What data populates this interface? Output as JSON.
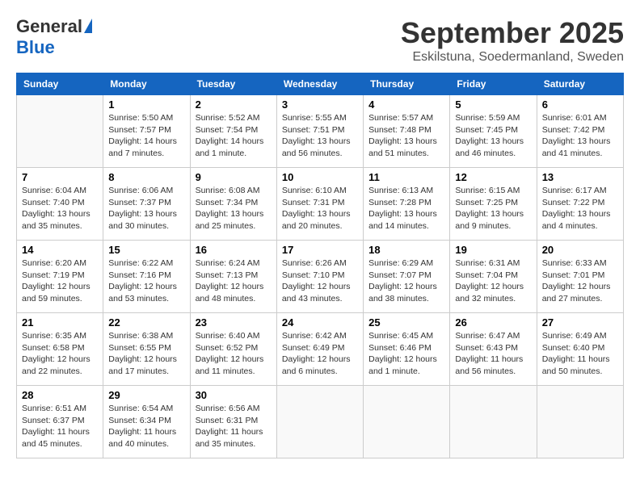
{
  "logo": {
    "general": "General",
    "blue": "Blue"
  },
  "title": "September 2025",
  "location": "Eskilstuna, Soedermanland, Sweden",
  "headers": [
    "Sunday",
    "Monday",
    "Tuesday",
    "Wednesday",
    "Thursday",
    "Friday",
    "Saturday"
  ],
  "weeks": [
    [
      {
        "day": "",
        "info": ""
      },
      {
        "day": "1",
        "info": "Sunrise: 5:50 AM\nSunset: 7:57 PM\nDaylight: 14 hours\nand 7 minutes."
      },
      {
        "day": "2",
        "info": "Sunrise: 5:52 AM\nSunset: 7:54 PM\nDaylight: 14 hours\nand 1 minute."
      },
      {
        "day": "3",
        "info": "Sunrise: 5:55 AM\nSunset: 7:51 PM\nDaylight: 13 hours\nand 56 minutes."
      },
      {
        "day": "4",
        "info": "Sunrise: 5:57 AM\nSunset: 7:48 PM\nDaylight: 13 hours\nand 51 minutes."
      },
      {
        "day": "5",
        "info": "Sunrise: 5:59 AM\nSunset: 7:45 PM\nDaylight: 13 hours\nand 46 minutes."
      },
      {
        "day": "6",
        "info": "Sunrise: 6:01 AM\nSunset: 7:42 PM\nDaylight: 13 hours\nand 41 minutes."
      }
    ],
    [
      {
        "day": "7",
        "info": "Sunrise: 6:04 AM\nSunset: 7:40 PM\nDaylight: 13 hours\nand 35 minutes."
      },
      {
        "day": "8",
        "info": "Sunrise: 6:06 AM\nSunset: 7:37 PM\nDaylight: 13 hours\nand 30 minutes."
      },
      {
        "day": "9",
        "info": "Sunrise: 6:08 AM\nSunset: 7:34 PM\nDaylight: 13 hours\nand 25 minutes."
      },
      {
        "day": "10",
        "info": "Sunrise: 6:10 AM\nSunset: 7:31 PM\nDaylight: 13 hours\nand 20 minutes."
      },
      {
        "day": "11",
        "info": "Sunrise: 6:13 AM\nSunset: 7:28 PM\nDaylight: 13 hours\nand 14 minutes."
      },
      {
        "day": "12",
        "info": "Sunrise: 6:15 AM\nSunset: 7:25 PM\nDaylight: 13 hours\nand 9 minutes."
      },
      {
        "day": "13",
        "info": "Sunrise: 6:17 AM\nSunset: 7:22 PM\nDaylight: 13 hours\nand 4 minutes."
      }
    ],
    [
      {
        "day": "14",
        "info": "Sunrise: 6:20 AM\nSunset: 7:19 PM\nDaylight: 12 hours\nand 59 minutes."
      },
      {
        "day": "15",
        "info": "Sunrise: 6:22 AM\nSunset: 7:16 PM\nDaylight: 12 hours\nand 53 minutes."
      },
      {
        "day": "16",
        "info": "Sunrise: 6:24 AM\nSunset: 7:13 PM\nDaylight: 12 hours\nand 48 minutes."
      },
      {
        "day": "17",
        "info": "Sunrise: 6:26 AM\nSunset: 7:10 PM\nDaylight: 12 hours\nand 43 minutes."
      },
      {
        "day": "18",
        "info": "Sunrise: 6:29 AM\nSunset: 7:07 PM\nDaylight: 12 hours\nand 38 minutes."
      },
      {
        "day": "19",
        "info": "Sunrise: 6:31 AM\nSunset: 7:04 PM\nDaylight: 12 hours\nand 32 minutes."
      },
      {
        "day": "20",
        "info": "Sunrise: 6:33 AM\nSunset: 7:01 PM\nDaylight: 12 hours\nand 27 minutes."
      }
    ],
    [
      {
        "day": "21",
        "info": "Sunrise: 6:35 AM\nSunset: 6:58 PM\nDaylight: 12 hours\nand 22 minutes."
      },
      {
        "day": "22",
        "info": "Sunrise: 6:38 AM\nSunset: 6:55 PM\nDaylight: 12 hours\nand 17 minutes."
      },
      {
        "day": "23",
        "info": "Sunrise: 6:40 AM\nSunset: 6:52 PM\nDaylight: 12 hours\nand 11 minutes."
      },
      {
        "day": "24",
        "info": "Sunrise: 6:42 AM\nSunset: 6:49 PM\nDaylight: 12 hours\nand 6 minutes."
      },
      {
        "day": "25",
        "info": "Sunrise: 6:45 AM\nSunset: 6:46 PM\nDaylight: 12 hours\nand 1 minute."
      },
      {
        "day": "26",
        "info": "Sunrise: 6:47 AM\nSunset: 6:43 PM\nDaylight: 11 hours\nand 56 minutes."
      },
      {
        "day": "27",
        "info": "Sunrise: 6:49 AM\nSunset: 6:40 PM\nDaylight: 11 hours\nand 50 minutes."
      }
    ],
    [
      {
        "day": "28",
        "info": "Sunrise: 6:51 AM\nSunset: 6:37 PM\nDaylight: 11 hours\nand 45 minutes."
      },
      {
        "day": "29",
        "info": "Sunrise: 6:54 AM\nSunset: 6:34 PM\nDaylight: 11 hours\nand 40 minutes."
      },
      {
        "day": "30",
        "info": "Sunrise: 6:56 AM\nSunset: 6:31 PM\nDaylight: 11 hours\nand 35 minutes."
      },
      {
        "day": "",
        "info": ""
      },
      {
        "day": "",
        "info": ""
      },
      {
        "day": "",
        "info": ""
      },
      {
        "day": "",
        "info": ""
      }
    ]
  ]
}
